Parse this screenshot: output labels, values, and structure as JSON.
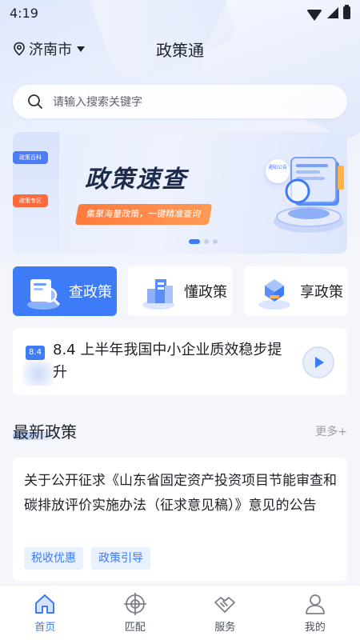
{
  "status_bar": {
    "time": "4:19"
  },
  "header": {
    "location": "济南市",
    "title": "政策通"
  },
  "search": {
    "placeholder": "请输入搜索关键字"
  },
  "banner": {
    "title": "政策速查",
    "subtitle": "集聚海量政策，一键精准查询",
    "notice": "通知公告",
    "side_chip_1": "政策百科",
    "side_chip_2": "政策专区",
    "page_count": 3,
    "active_page": 1
  },
  "quick_entries": [
    {
      "label": "查政策"
    },
    {
      "label": "懂政策"
    },
    {
      "label": "享政策"
    }
  ],
  "audio_card": {
    "badge": "8.4",
    "text": "8.4 上半年我国中小企业质效稳步提升"
  },
  "latest": {
    "title": "最新政策",
    "more": "更多+"
  },
  "policy": {
    "title": "关于公开征求《山东省固定资产投资项目节能审查和碳排放评价实施办法（征求意见稿）》意见的公告",
    "tags": [
      "税收优惠",
      "政策引导"
    ]
  },
  "nav": [
    {
      "label": "首页",
      "icon": "home-icon",
      "active": true
    },
    {
      "label": "匹配",
      "icon": "target-icon",
      "active": false
    },
    {
      "label": "服务",
      "icon": "handshake-icon",
      "active": false
    },
    {
      "label": "我的",
      "icon": "user-icon",
      "active": false
    }
  ],
  "colors": {
    "accent": "#3e7bf6",
    "highlight": "#ff7a3d",
    "background": "#f4f6fb"
  }
}
